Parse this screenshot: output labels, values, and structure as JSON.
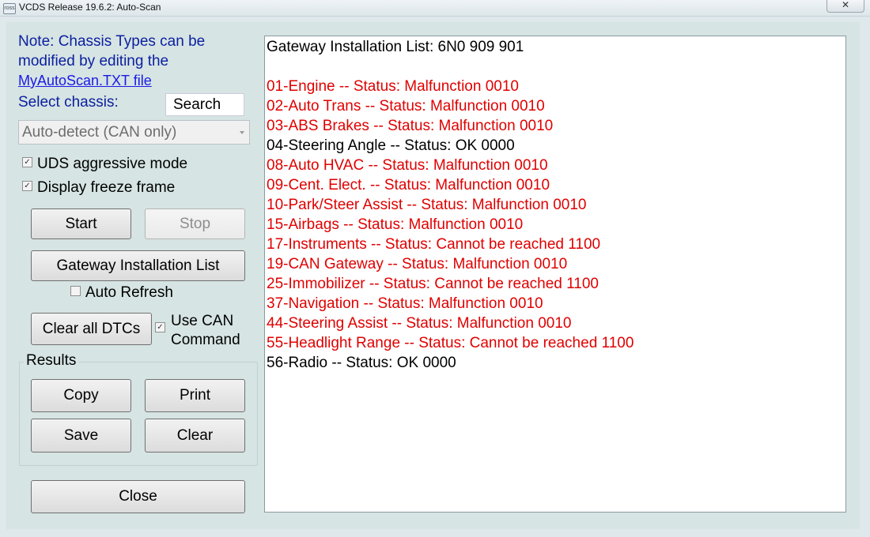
{
  "window": {
    "title": "VCDS Release 19.6.2:  Auto-Scan",
    "icon_text": "ross",
    "close_glyph": "✕"
  },
  "left": {
    "note_lines": [
      "Note:  Chassis Types can be",
      "modified by editing the"
    ],
    "link": "MyAutoScan.TXT file",
    "select_label": "Select chassis:",
    "search_value": "Search",
    "chassis_value": "Auto-detect (CAN only)",
    "uds_label": "UDS aggressive mode",
    "freeze_label": "Display freeze frame",
    "start_label": "Start",
    "stop_label": "Stop",
    "gateway_label": "Gateway Installation List",
    "auto_refresh_label": "Auto Refresh",
    "clear_dtcs_label": "Clear all DTCs",
    "use_can_lines": [
      "Use CAN",
      "Command"
    ],
    "results_group_label": "Results",
    "copy_label": "Copy",
    "print_label": "Print",
    "save_label": "Save",
    "clear_label": "Clear",
    "close_label": "Close",
    "checks": {
      "uds": true,
      "freeze": true,
      "auto_refresh": false,
      "use_can": true
    }
  },
  "results": {
    "header": "Gateway Installation List:  6N0 909 901",
    "lines": [
      {
        "text": "01-Engine -- Status: Malfunction 0010",
        "status": "fault"
      },
      {
        "text": "02-Auto Trans -- Status: Malfunction 0010",
        "status": "fault"
      },
      {
        "text": "03-ABS Brakes -- Status: Malfunction 0010",
        "status": "fault"
      },
      {
        "text": "04-Steering Angle -- Status: OK 0000",
        "status": "ok"
      },
      {
        "text": "08-Auto HVAC -- Status: Malfunction 0010",
        "status": "fault"
      },
      {
        "text": "09-Cent. Elect. -- Status: Malfunction 0010",
        "status": "fault"
      },
      {
        "text": "10-Park/Steer Assist -- Status: Malfunction 0010",
        "status": "fault"
      },
      {
        "text": "15-Airbags -- Status: Malfunction 0010",
        "status": "fault"
      },
      {
        "text": "17-Instruments -- Status: Cannot be reached 1100",
        "status": "fault"
      },
      {
        "text": "19-CAN Gateway -- Status: Malfunction 0010",
        "status": "fault"
      },
      {
        "text": "25-Immobilizer -- Status: Cannot be reached 1100",
        "status": "fault"
      },
      {
        "text": "37-Navigation -- Status: Malfunction 0010",
        "status": "fault"
      },
      {
        "text": "44-Steering Assist -- Status: Malfunction 0010",
        "status": "fault"
      },
      {
        "text": "55-Headlight Range -- Status: Cannot be reached 1100",
        "status": "fault"
      },
      {
        "text": "56-Radio -- Status: OK 0000",
        "status": "ok"
      }
    ]
  },
  "colors": {
    "fault": "#e00000",
    "ok": "#000000",
    "label_blue": "#0b1fa0",
    "link": "#1a1ae6"
  }
}
